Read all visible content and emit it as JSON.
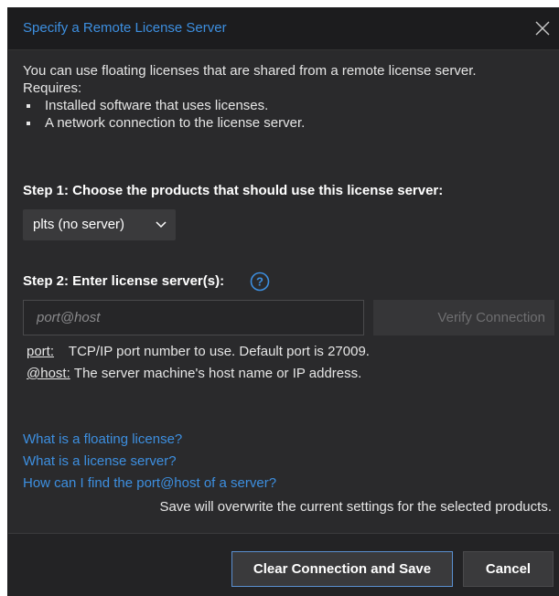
{
  "dialog": {
    "title": "Specify a Remote License Server",
    "close_icon": "close-icon"
  },
  "intro": {
    "line1": "You can use floating licenses that are shared from a remote license server.",
    "line2": "Requires:",
    "bullets": [
      "Installed software that uses licenses.",
      "A network connection to the license server."
    ]
  },
  "step1": {
    "label": "Step 1: Choose the products that should use this license server:",
    "selected_product": "plts (no server)",
    "dropdown_icon": "chevron-down-icon"
  },
  "step2": {
    "label": "Step 2: Enter license server(s):",
    "help_icon": "question-circle-icon",
    "input_value": "",
    "input_placeholder": "port@host",
    "verify_label": "Verify Connection"
  },
  "descriptions": {
    "port_term": "port:",
    "port_text": "TCP/IP port number to use. Default port is 27009.",
    "host_term": "@host:",
    "host_text": "The server machine's host name or IP address."
  },
  "links": [
    "What is a floating license?",
    "What is a license server?",
    "How can I find the port@host of a server?"
  ],
  "save_note": "Save will overwrite the current settings for the selected products.",
  "footer": {
    "clear_save_label": "Clear Connection and Save",
    "cancel_label": "Cancel"
  },
  "colors": {
    "accent_link": "#3d8fe0",
    "dialog_bg": "#2a2a2c",
    "titlebar_bg": "#1c1c1e",
    "primary_border": "#5a8fcf"
  }
}
